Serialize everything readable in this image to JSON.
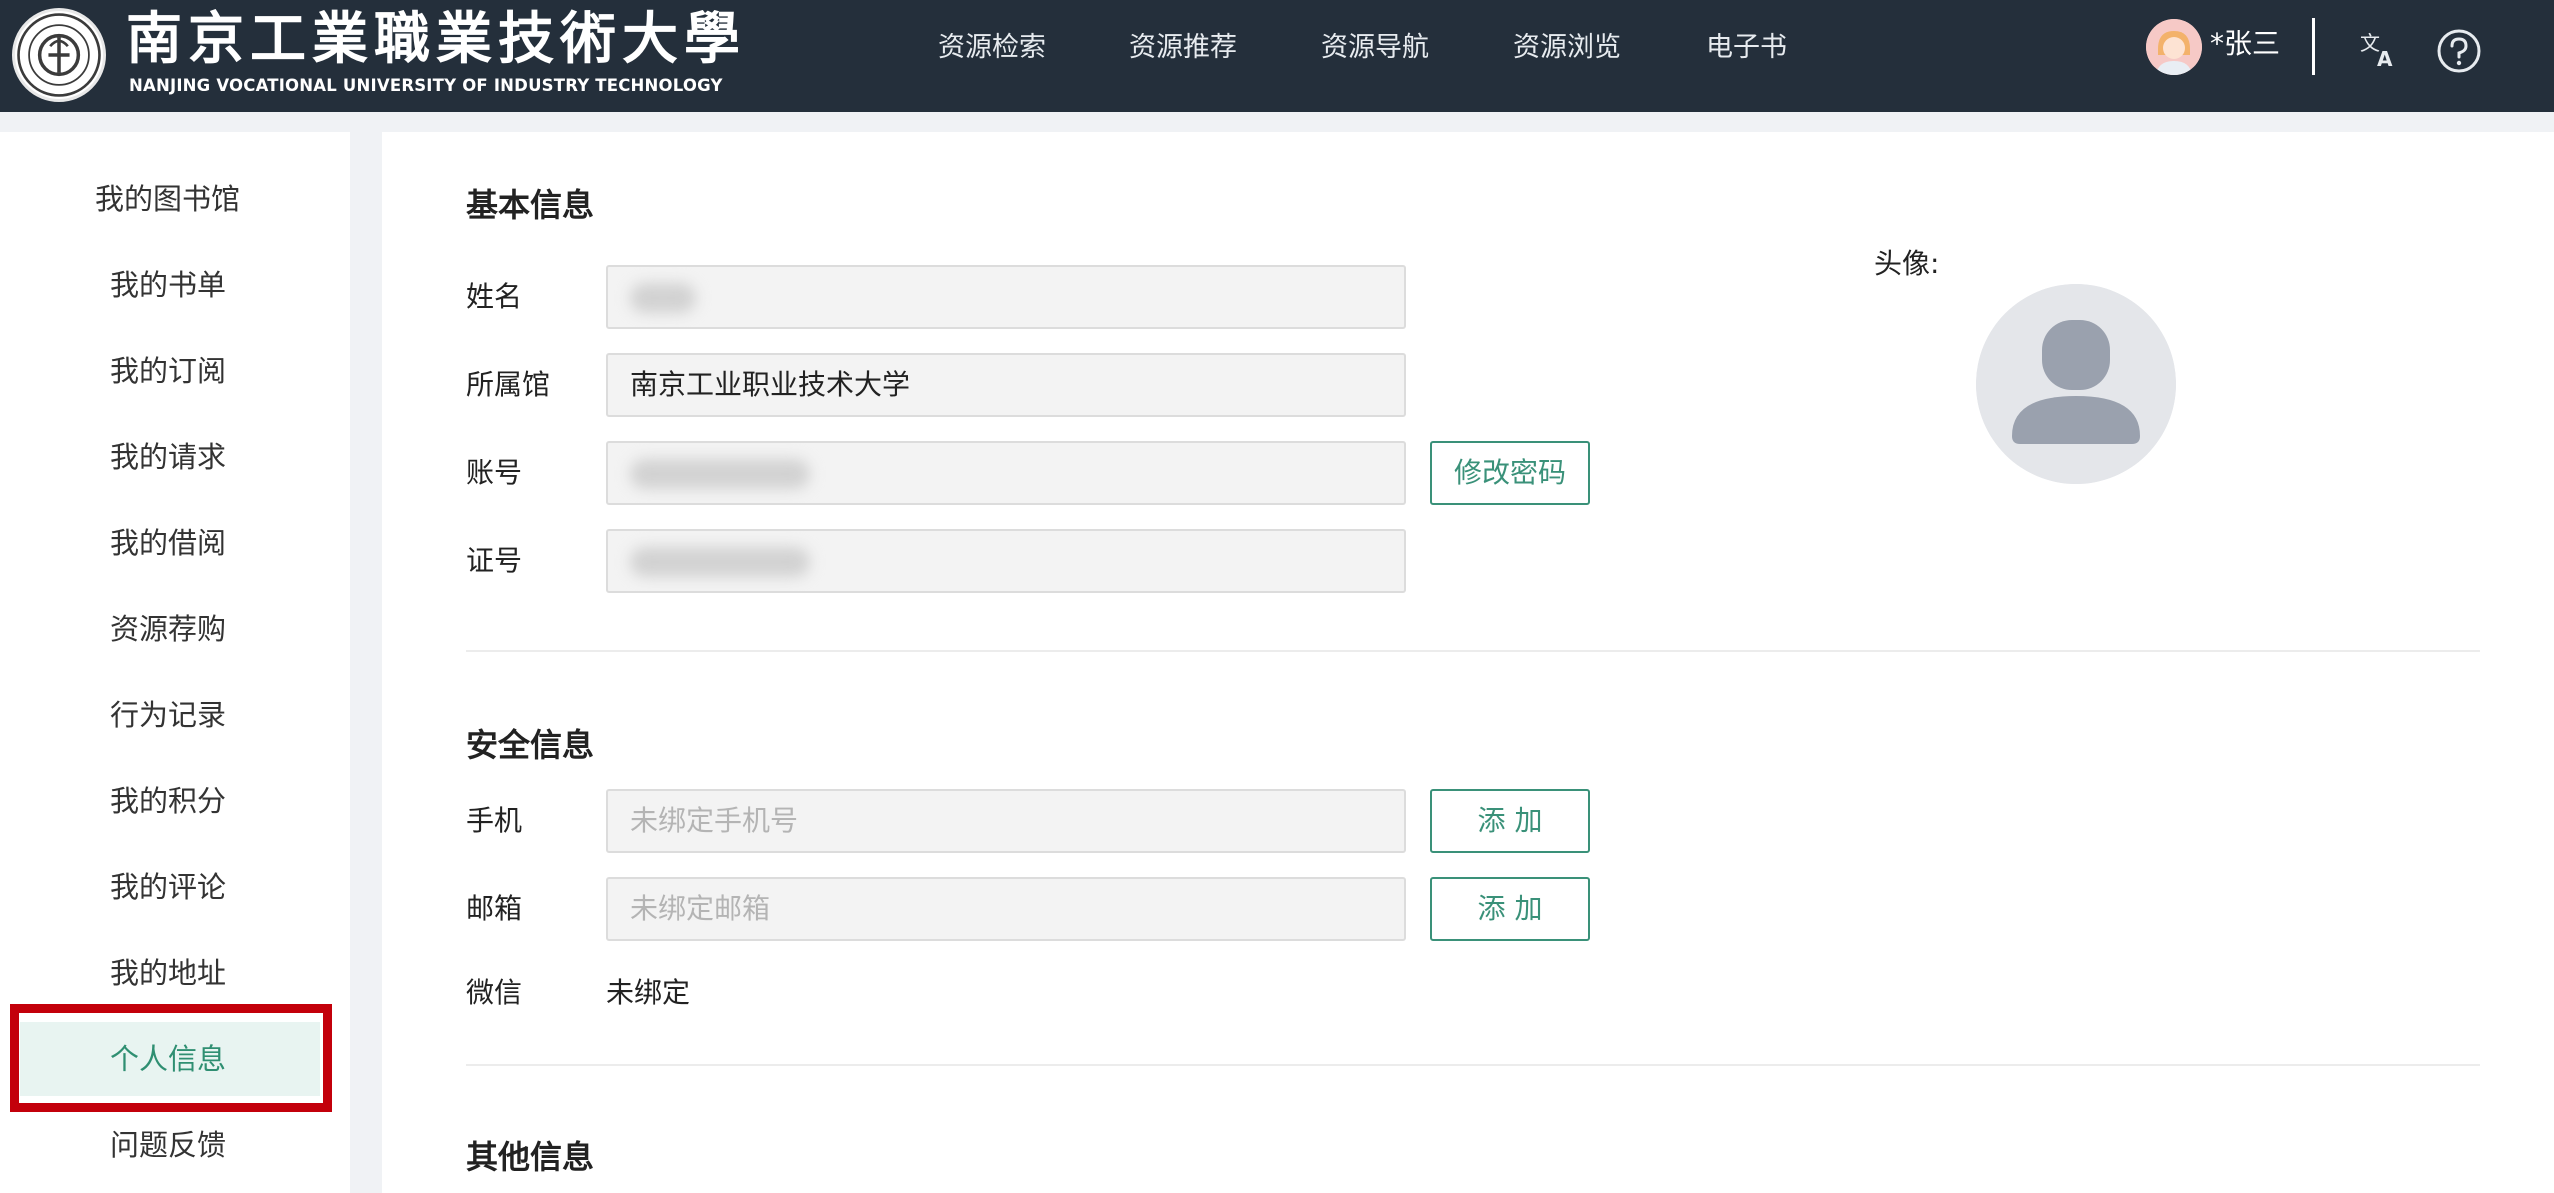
{
  "header": {
    "logo_cn": "南京工業職業技術大學",
    "logo_en": "NANJING VOCATIONAL UNIVERSITY OF INDUSTRY TECHNOLOGY",
    "nav": [
      "资源检索",
      "资源推荐",
      "资源导航",
      "资源浏览",
      "电子书"
    ],
    "user_name": "*张三",
    "icons": {
      "translate": "translate-icon",
      "help": "help-icon"
    }
  },
  "sidebar": {
    "items": [
      {
        "label": "我的图书馆"
      },
      {
        "label": "我的书单"
      },
      {
        "label": "我的订阅"
      },
      {
        "label": "我的请求"
      },
      {
        "label": "我的借阅"
      },
      {
        "label": "资源荐购"
      },
      {
        "label": "行为记录"
      },
      {
        "label": "我的积分"
      },
      {
        "label": "我的评论"
      },
      {
        "label": "我的地址"
      },
      {
        "label": "个人信息",
        "active": true
      },
      {
        "label": "问题反馈"
      }
    ]
  },
  "basic_info": {
    "title": "基本信息",
    "name_label": "姓名",
    "library_label": "所属馆",
    "library_value": "南京工业职业技术大学",
    "account_label": "账号",
    "change_password_button": "修改密码",
    "card_label": "证号",
    "avatar_label": "头像:"
  },
  "security_info": {
    "title": "安全信息",
    "phone_label": "手机",
    "phone_placeholder": "未绑定手机号",
    "phone_add_button": "添 加",
    "email_label": "邮箱",
    "email_placeholder": "未绑定邮箱",
    "email_add_button": "添 加",
    "wechat_label": "微信",
    "wechat_value": "未绑定"
  },
  "other_info": {
    "title": "其他信息"
  },
  "colors": {
    "header_bg": "#242f3b",
    "accent_green": "#3a9179",
    "active_bg": "#e8f4f1",
    "highlight_red": "#c3000b"
  }
}
